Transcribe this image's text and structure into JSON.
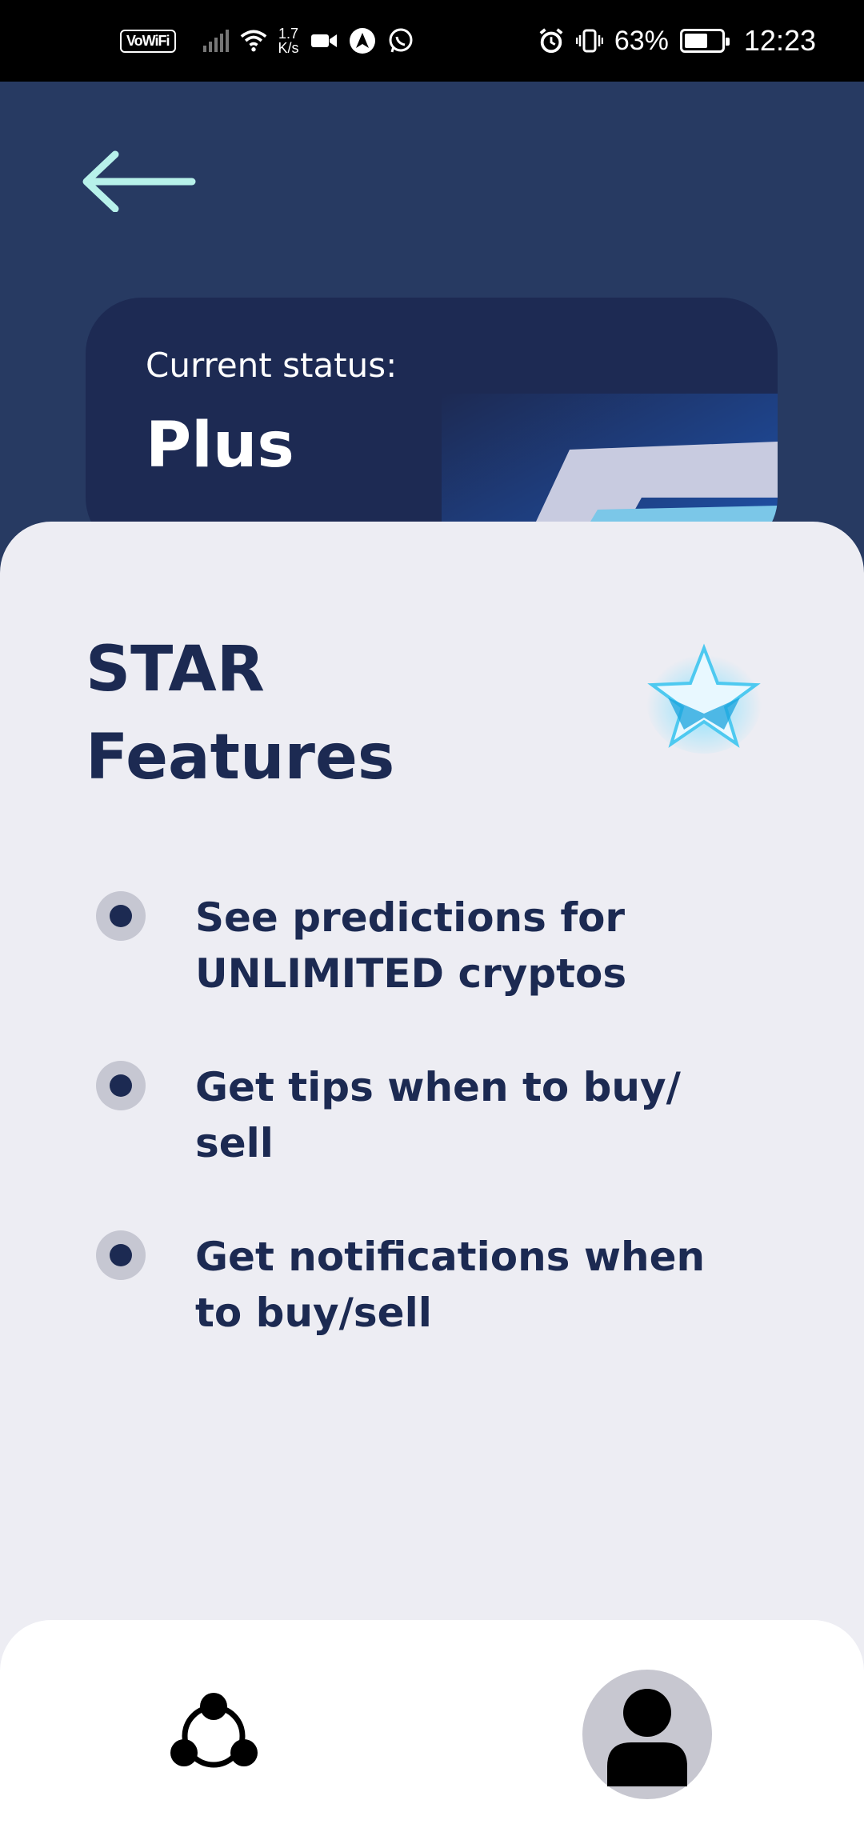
{
  "status_bar": {
    "vowifi": "VoWiFi",
    "net_speed_value": "1.7",
    "net_speed_unit": "K/s",
    "battery_percent": "63%",
    "time": "12:23"
  },
  "card": {
    "status_label": "Current status:",
    "status_value": "Plus"
  },
  "features": {
    "title_line1": "STAR",
    "title_line2": "Features",
    "items": [
      {
        "text": "See predictions for UNLIMITED cryptos"
      },
      {
        "text": "Get tips when to buy/ sell"
      },
      {
        "text": "Get notifications when to buy/sell"
      }
    ]
  },
  "colors": {
    "header_bg": "#273a62",
    "card_bg": "#1d2a53",
    "sheet_bg": "#ededf3",
    "text_dark": "#1c2a52",
    "arrow": "#b7f1ea"
  },
  "icons": {
    "back": "arrow-left-icon",
    "star": "star-icon",
    "network": "network-icon",
    "profile": "user-icon"
  }
}
